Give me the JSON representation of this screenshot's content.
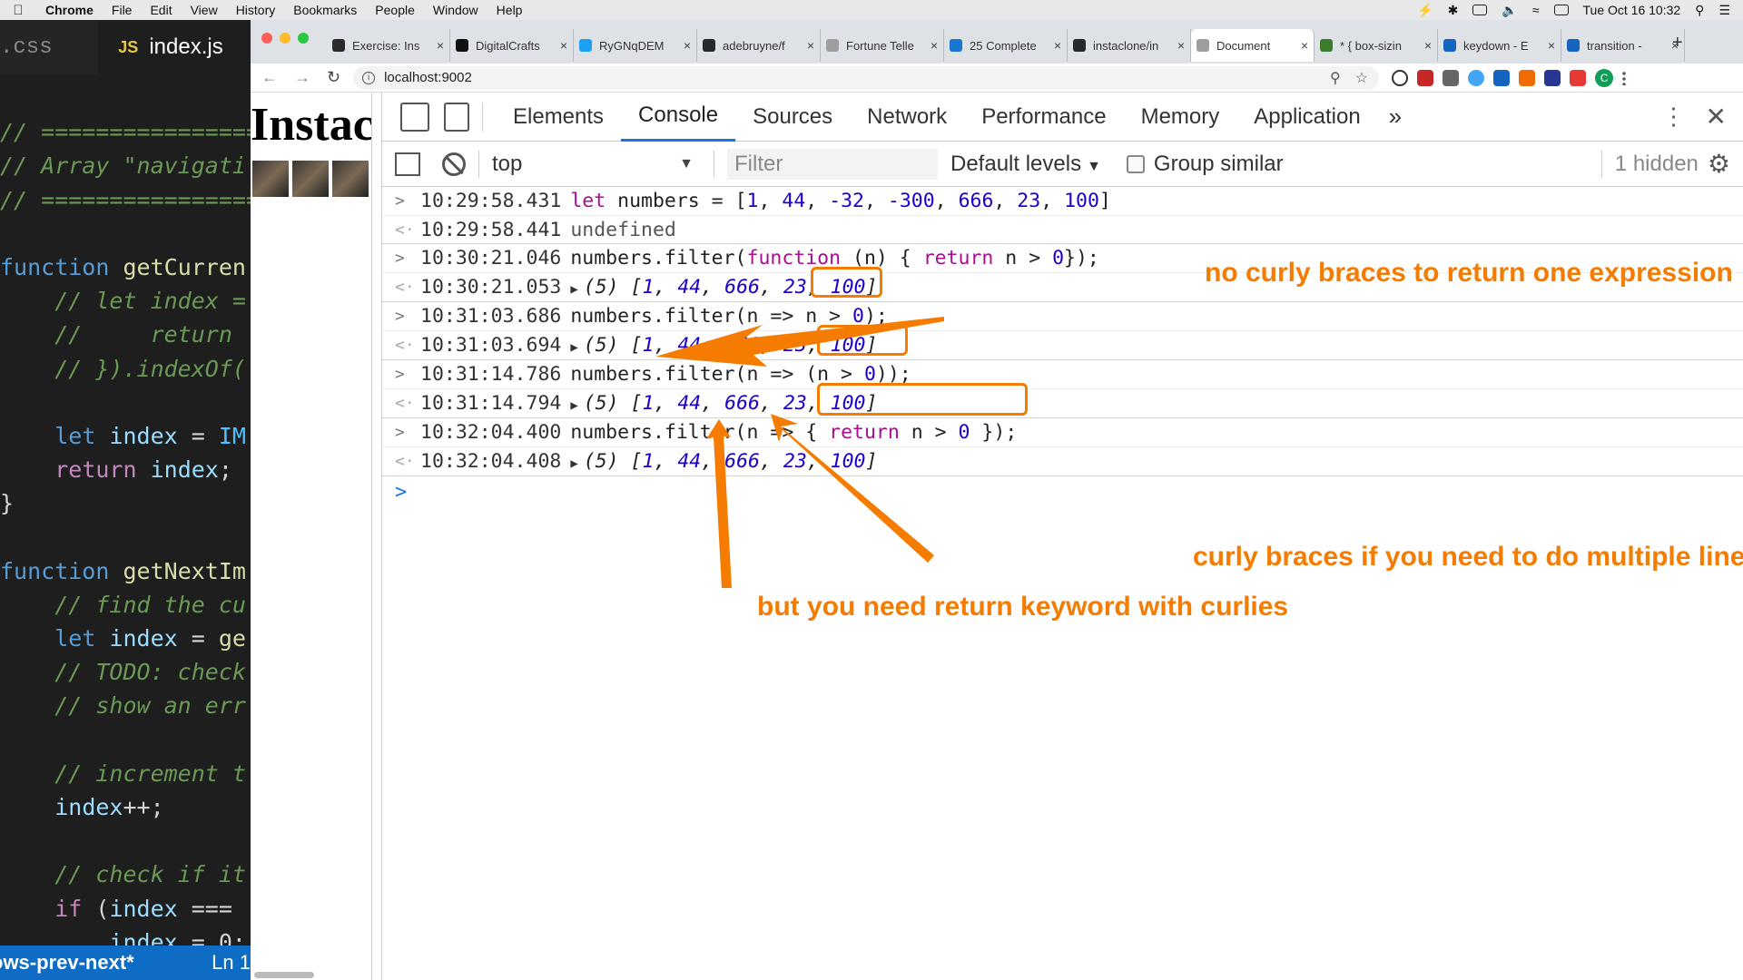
{
  "menubar": {
    "apple": "",
    "items": [
      "Chrome",
      "File",
      "Edit",
      "View",
      "History",
      "Bookmarks",
      "People",
      "Window",
      "Help"
    ],
    "clock": "Tue Oct 16  10:32"
  },
  "editor": {
    "tab_css": ".css",
    "tab_js_icon": "JS",
    "tab_js": "index.js",
    "status_left": "ows-prev-next*",
    "status_right": "Ln 1"
  },
  "browser": {
    "tabs": [
      {
        "title": "Exercise: Ins",
        "color": "#2a2a2a"
      },
      {
        "title": "DigitalCrafts",
        "color": "#111111"
      },
      {
        "title": "RyGNqDEM",
        "color": "#1da1f2"
      },
      {
        "title": "adebruyne/f",
        "color": "#24292e"
      },
      {
        "title": "Fortune Telle",
        "color": "#9e9e9e"
      },
      {
        "title": "25 Complete",
        "color": "#1976d2"
      },
      {
        "title": "instaclone/in",
        "color": "#24292e"
      },
      {
        "title": "Document",
        "color": "#9e9e9e"
      },
      {
        "title": "* { box-sizin",
        "color": "#3b7d2c"
      },
      {
        "title": "keydown - E",
        "color": "#1565c0"
      },
      {
        "title": "transition - ",
        "color": "#1565c0"
      }
    ],
    "url": "localhost:9002"
  },
  "page": {
    "heading": "Instac"
  },
  "devtools": {
    "tabs": [
      "Elements",
      "Console",
      "Sources",
      "Network",
      "Performance",
      "Memory",
      "Application"
    ],
    "active_tab": "Console",
    "more": "»",
    "context": "top",
    "filter_placeholder": "Filter",
    "levels": "Default levels",
    "group_similar": "Group similar",
    "hidden": "1 hidden"
  },
  "console": {
    "rows": [
      {
        "kind": "in",
        "ts": "10:29:58.431",
        "code": "let numbers = [1, 44, -32, -300, 666, 23, 100]"
      },
      {
        "kind": "out",
        "ts": "10:29:58.441",
        "text": "undefined"
      },
      {
        "kind": "in",
        "ts": "10:30:21.046",
        "code": "numbers.filter(function (n) { return n > 0});"
      },
      {
        "kind": "out",
        "ts": "10:30:21.053",
        "text": "(5) [1, 44, 666, 23, 100]"
      },
      {
        "kind": "in",
        "ts": "10:31:03.686",
        "code": "numbers.filter(n => n > 0);"
      },
      {
        "kind": "out",
        "ts": "10:31:03.694",
        "text": "(5) [1, 44, 666, 23, 100]"
      },
      {
        "kind": "in",
        "ts": "10:31:14.786",
        "code": "numbers.filter(n => (n > 0));"
      },
      {
        "kind": "out",
        "ts": "10:31:14.794",
        "text": "(5) [1, 44, 666, 23, 100]"
      },
      {
        "kind": "in",
        "ts": "10:32:04.400",
        "code": "numbers.filter(n => { return n > 0 });"
      },
      {
        "kind": "out",
        "ts": "10:32:04.408",
        "text": "(5) [1, 44, 666, 23, 100]"
      }
    ],
    "prompt": ">"
  },
  "annotations": {
    "note1": "no curly braces to return one expression",
    "note2": "curly braces if you need to do multiple lines.",
    "note3": "but you need return keyword with curlies",
    "color": "#f57c00"
  }
}
